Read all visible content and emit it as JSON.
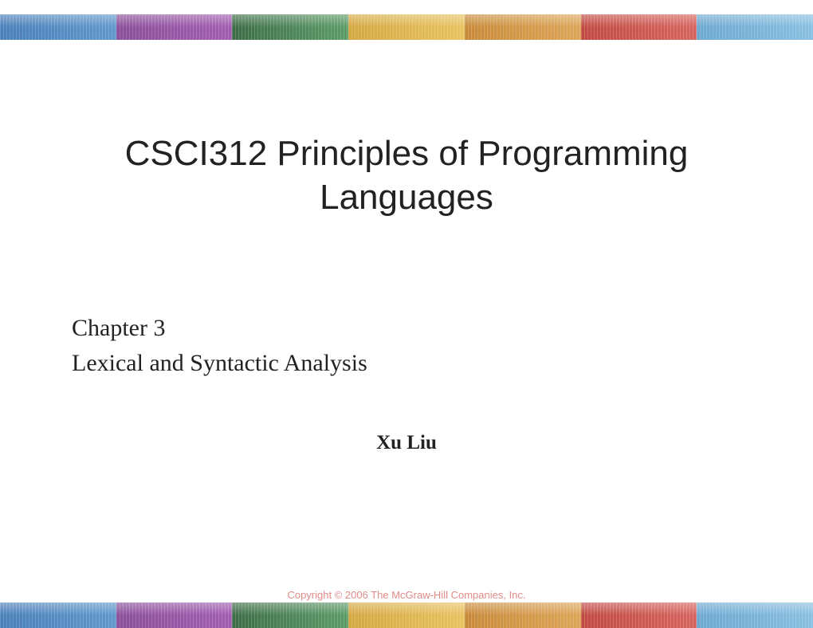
{
  "title": "CSCI312 Principles of Programming Languages",
  "chapter_line1": "Chapter 3",
  "chapter_line2": "Lexical and Syntactic Analysis",
  "author": "Xu Liu",
  "copyright": "Copyright © 2006 The McGraw-Hill Companies, Inc."
}
